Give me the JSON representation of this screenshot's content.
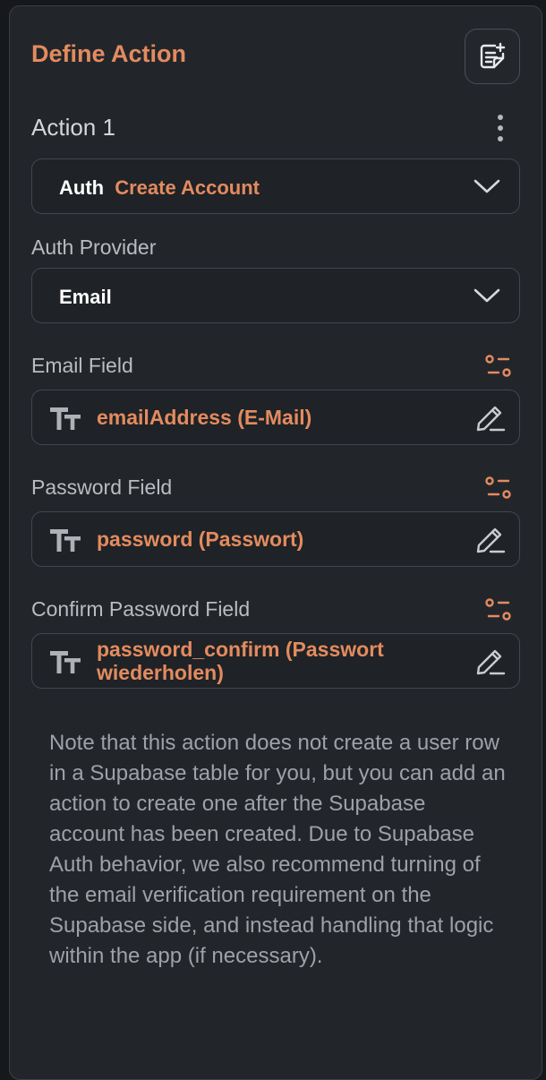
{
  "header": {
    "title": "Define Action"
  },
  "icons": {
    "add_note": "note-add-icon",
    "more": "more-vertical-icon",
    "chevron": "chevron-down-icon",
    "text_type": "text-type-icon",
    "edit": "pencil-icon",
    "options": "sliders-icon"
  },
  "colors": {
    "accent": "#e38b5f",
    "panel": "#22262b",
    "border": "#42474f"
  },
  "action": {
    "title": "Action 1",
    "type_prefix": "Auth",
    "type_value": "Create Account"
  },
  "auth_provider": {
    "label": "Auth Provider",
    "value": "Email"
  },
  "email_field": {
    "label": "Email Field",
    "value": "emailAddress (E-Mail)"
  },
  "password_field": {
    "label": "Password Field",
    "value": "password (Passwort)"
  },
  "confirm_password_field": {
    "label": "Confirm Password Field",
    "value": "password_confirm (Passwort wiederholen)"
  },
  "note": "Note that this action does not create a user row in a Supabase table for you, but you can add an action to create one after the Supabase account has been created. Due to Supabase Auth behavior, we also recommend turning of the email verification requirement on the Supabase side, and instead handling that logic within the app (if necessary)."
}
